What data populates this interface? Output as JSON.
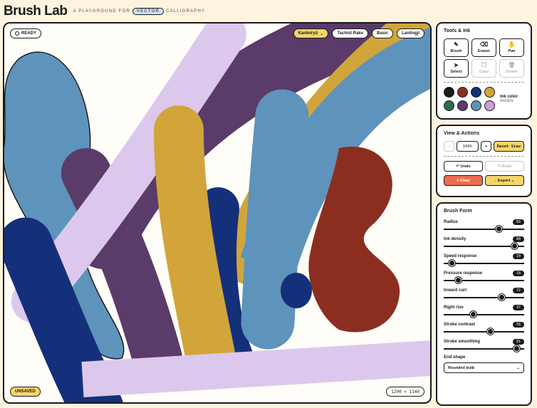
{
  "app": {
    "logo": "Brush Lab",
    "tagline_pre": "A playground for",
    "tagline_pill": "vector",
    "tagline_post": "calligraphy."
  },
  "canvas": {
    "status": "READY",
    "save_state": "UNSAVED",
    "size": "1290 × 1140",
    "presets": [
      {
        "label": "Kanteiryū",
        "active": true
      },
      {
        "label": "Tachist Rake",
        "active": false
      },
      {
        "label": "Basic",
        "active": false
      },
      {
        "label": "Lantingji",
        "active": false
      }
    ]
  },
  "tools": {
    "title": "Tools & Ink",
    "items": [
      {
        "label": "Brush",
        "icon": "brush-icon",
        "glyph": "✎",
        "enabled": true
      },
      {
        "label": "Eraser",
        "icon": "eraser-icon",
        "glyph": "⌫",
        "enabled": true
      },
      {
        "label": "Pan",
        "icon": "hand-icon",
        "glyph": "✋",
        "enabled": true
      },
      {
        "label": "Select",
        "icon": "cursor-icon",
        "glyph": "➤",
        "enabled": true
      },
      {
        "label": "Copy",
        "icon": "copy-icon",
        "glyph": "❐",
        "enabled": false
      },
      {
        "label": "Delete",
        "icon": "trash-icon",
        "glyph": "🗑",
        "enabled": false
      }
    ],
    "swatches": [
      "#1b1b1b",
      "#8b2e1f",
      "#14307a",
      "#d1a53a",
      "#2f6b4c",
      "#5b3a6b",
      "#5e93bb",
      "#cf9cd8"
    ],
    "ink_label": "Ink color",
    "ink_hex": "#943076"
  },
  "view": {
    "title": "View & Actions",
    "zoom_out": "−",
    "zoom": "100%",
    "zoom_in": "+",
    "reset": "Reset View",
    "undo": "↶ Undo",
    "redo": "↷ Redo",
    "clear": "× Clear",
    "export": "↓ Export ⌄"
  },
  "brush": {
    "title": "Brush Form",
    "sliders": [
      {
        "label": "Radius",
        "value": "69",
        "fraction": 0.69
      },
      {
        "label": "Ink density",
        "value": "88",
        "fraction": 0.88
      },
      {
        "label": "Speed response",
        "value": "10",
        "fraction": 0.1
      },
      {
        "label": "Pressure response",
        "value": "18",
        "fraction": 0.18
      },
      {
        "label": "Inward curl",
        "value": "72",
        "fraction": 0.72
      },
      {
        "label": "Right rise",
        "value": "37",
        "fraction": 0.37
      },
      {
        "label": "Stroke contrast",
        "value": "58",
        "fraction": 0.58
      },
      {
        "label": "Stroke smoothing",
        "value": "91",
        "fraction": 0.91
      }
    ],
    "end_shape_label": "End shape",
    "end_shape_value": "Rounded bulb"
  }
}
